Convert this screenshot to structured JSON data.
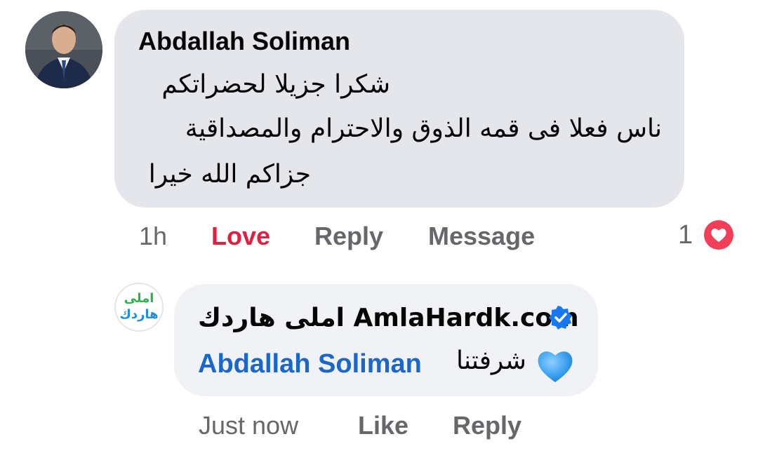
{
  "comment": {
    "author": "Abdallah Soliman",
    "lines": [
      "شكرا جزيلا لحضراتكم",
      "ناس فعلا فى قمه الذوق والاحترام والمصداقية",
      "جزاكم الله خيرا"
    ],
    "time": "1h",
    "love_label": "Love",
    "reply_label": "Reply",
    "message_label": "Message",
    "reaction_count": "1",
    "reaction_icon": "heart-icon",
    "love_color": "#e41e3f"
  },
  "reply": {
    "avatar_logo_top": "املى",
    "avatar_logo_bottom": "هاردك",
    "author": "AmlaHardk.com املى هاردك",
    "verified_icon": "verified-badge-icon",
    "mention": "Abdallah Soliman",
    "text": "شرفتنا",
    "emoji_icon": "blue-heart-icon",
    "time": "Just now",
    "like_label": "Like",
    "reply_label": "Reply",
    "mention_color": "#1b66c9"
  }
}
